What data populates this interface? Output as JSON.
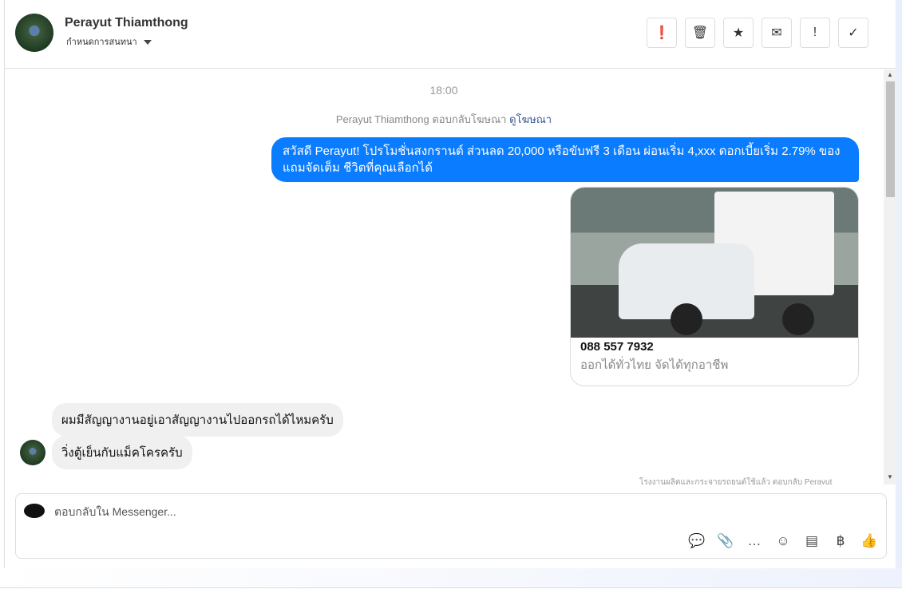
{
  "header": {
    "name": "Perayut Thiamthong",
    "subtitle": "กำหนดการสนทนา",
    "tools": [
      {
        "name": "spam-icon",
        "glyph": "❗"
      },
      {
        "name": "trash-icon",
        "glyph": "🗑"
      },
      {
        "name": "star-icon",
        "glyph": "★"
      },
      {
        "name": "mail-icon",
        "glyph": "✉"
      },
      {
        "name": "important-icon",
        "glyph": "!"
      },
      {
        "name": "check-icon",
        "glyph": "✓"
      }
    ]
  },
  "chat": {
    "time": "18:00",
    "ad_reply_text": "Perayut Thiamthong ตอบกลับโฆษณา",
    "ad_link": "ดูโฆษณา",
    "outgoing": "สวัสดี Perayut! โปรโมชั่นสงกรานต์ ส่วนลด 20,000 หรือขับฟรี 3 เดือน ผ่อนเริ่ม 4,xxx ดอกเบี้ยเริ่ม 2.79% ของแถมจัดเต็ม ชีวิตที่คุณเลือกได้",
    "card": {
      "phone": "088 557 7932",
      "desc": "ออกได้ทั่วไทย จัดได้ทุกอาชีพ"
    },
    "incoming": [
      "ผมมีสัญญางานอยู่เอาสัญญางานไปออกรถได้ไหมครับ",
      "วิ่งตู้เย็นกับแม็คโครครับ"
    ],
    "footnote": "โรงงานผลิตและกระจายรถยนต์ใช้แล้ว ตอบกลับ Perayut"
  },
  "composer": {
    "placeholder": "ตอบกลับใน Messenger...",
    "icons": [
      {
        "name": "saved-reply-icon",
        "glyph": "💬"
      },
      {
        "name": "attachment-icon",
        "glyph": "📎"
      },
      {
        "name": "chat-bubble-icon",
        "glyph": "…"
      },
      {
        "name": "emoji-icon",
        "glyph": "☺"
      },
      {
        "name": "catalog-icon",
        "glyph": "▤"
      },
      {
        "name": "baht-icon",
        "glyph": "฿"
      },
      {
        "name": "thumbs-up-icon",
        "glyph": "👍"
      }
    ]
  }
}
